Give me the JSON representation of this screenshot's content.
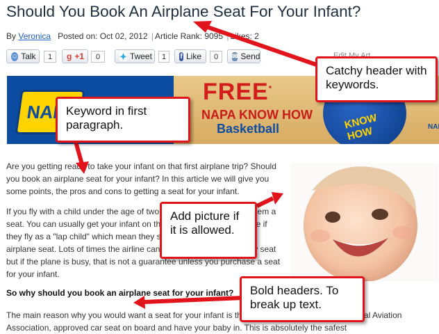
{
  "article": {
    "title": "Should You Book An Airplane Seat For Your Infant?",
    "meta": {
      "by_label": "By",
      "author": "Veronica",
      "posted_on": "Posted on: Oct 02, 2012",
      "article_rank": "Article Rank: 9095",
      "likes": "Likes: 2"
    },
    "paragraph_1": "Are you getting ready to take your infant on that first airplane trip? Should you book an airplane seat for your infant? In this article we will give you some points, the pros and cons to getting a seat for your infant.",
    "paragraph_2": "If you fly with a child under the age of two, you do not have to buy them a seat. You can usually get your infant on the plane for a discount price if they fly as a \"lap child\" which mean they sit on your lap in your own airplane seat. Lots of times the airline can seat you next to an empty seat but if the plane is busy, that is not a guarantee unless you purchase a seat for your infant.",
    "subheading": "So why should you book an airplane seat for your infant?",
    "paragraph_3": "The main reason why you would want a seat for your infant is that you can bring your FAA, Federal Aviation Association, approved car seat on board and have your baby in. This is absolutely the safest"
  },
  "share_bar": {
    "talk_label": "Talk",
    "talk_count": "1",
    "gplus_label": "+1",
    "gplus_count": "0",
    "tweet_label": "Tweet",
    "tweet_count": "1",
    "like_label": "Like",
    "like_count": "0",
    "send_label": "Send",
    "edit_link": "Edit My Art"
  },
  "banner": {
    "logo_text": "NAPA",
    "free_text": "FREE",
    "free_mark": "*",
    "line2": "NAPA KNOW HOW",
    "line3": "Basketball",
    "ball_text": "KNOW HOW",
    "edge_text": "NAPA"
  },
  "callouts": {
    "header": "Catchy header with keywords.",
    "keyword": "Keyword in first paragraph.",
    "picture": "Add picture if it is allowed.",
    "bold": "Bold headers. To break up text."
  },
  "colors": {
    "callout_border": "#e0141a",
    "link": "#1f5fbf",
    "napa_blue": "#0c4da2",
    "napa_yellow": "#ffd400"
  },
  "icons": [
    "talk-icon",
    "gplus-icon",
    "twitter-bird-icon",
    "facebook-icon",
    "send-icon"
  ]
}
